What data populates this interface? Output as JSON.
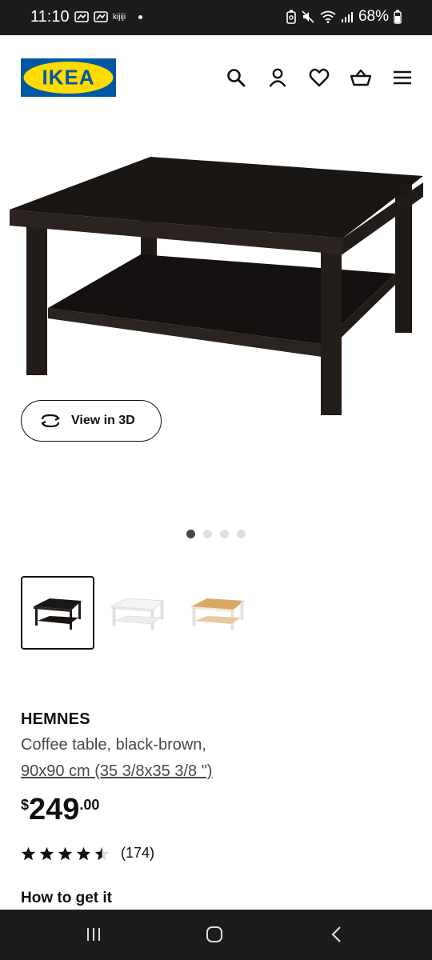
{
  "status_bar": {
    "time": "11:10",
    "app_label": "kijiji",
    "battery": "68%"
  },
  "header": {
    "logo_text": "IKEA",
    "icons": [
      "search-icon",
      "account-icon",
      "heart-icon",
      "basket-icon",
      "menu-icon"
    ]
  },
  "gallery": {
    "view3d_label": "View in 3D",
    "image_count": 4,
    "active_index": 0
  },
  "variants": [
    {
      "name": "black-brown",
      "selected": true
    },
    {
      "name": "white",
      "selected": false
    },
    {
      "name": "white stain/light brown",
      "selected": false
    }
  ],
  "product": {
    "name": "HEMNES",
    "description": "Coffee table, black-brown,",
    "size": "90x90 cm (35 3/8x35 3/8 \")",
    "price_currency": "$",
    "price_main": "249",
    "price_cents": ".00",
    "rating_value": 4.5,
    "rating_count": "(174)"
  },
  "sections": {
    "how_to_get": "How to get it"
  },
  "colors": {
    "brand_blue": "#0058a3",
    "brand_yellow": "#ffdb00",
    "system_bar": "#1c1c1e"
  }
}
